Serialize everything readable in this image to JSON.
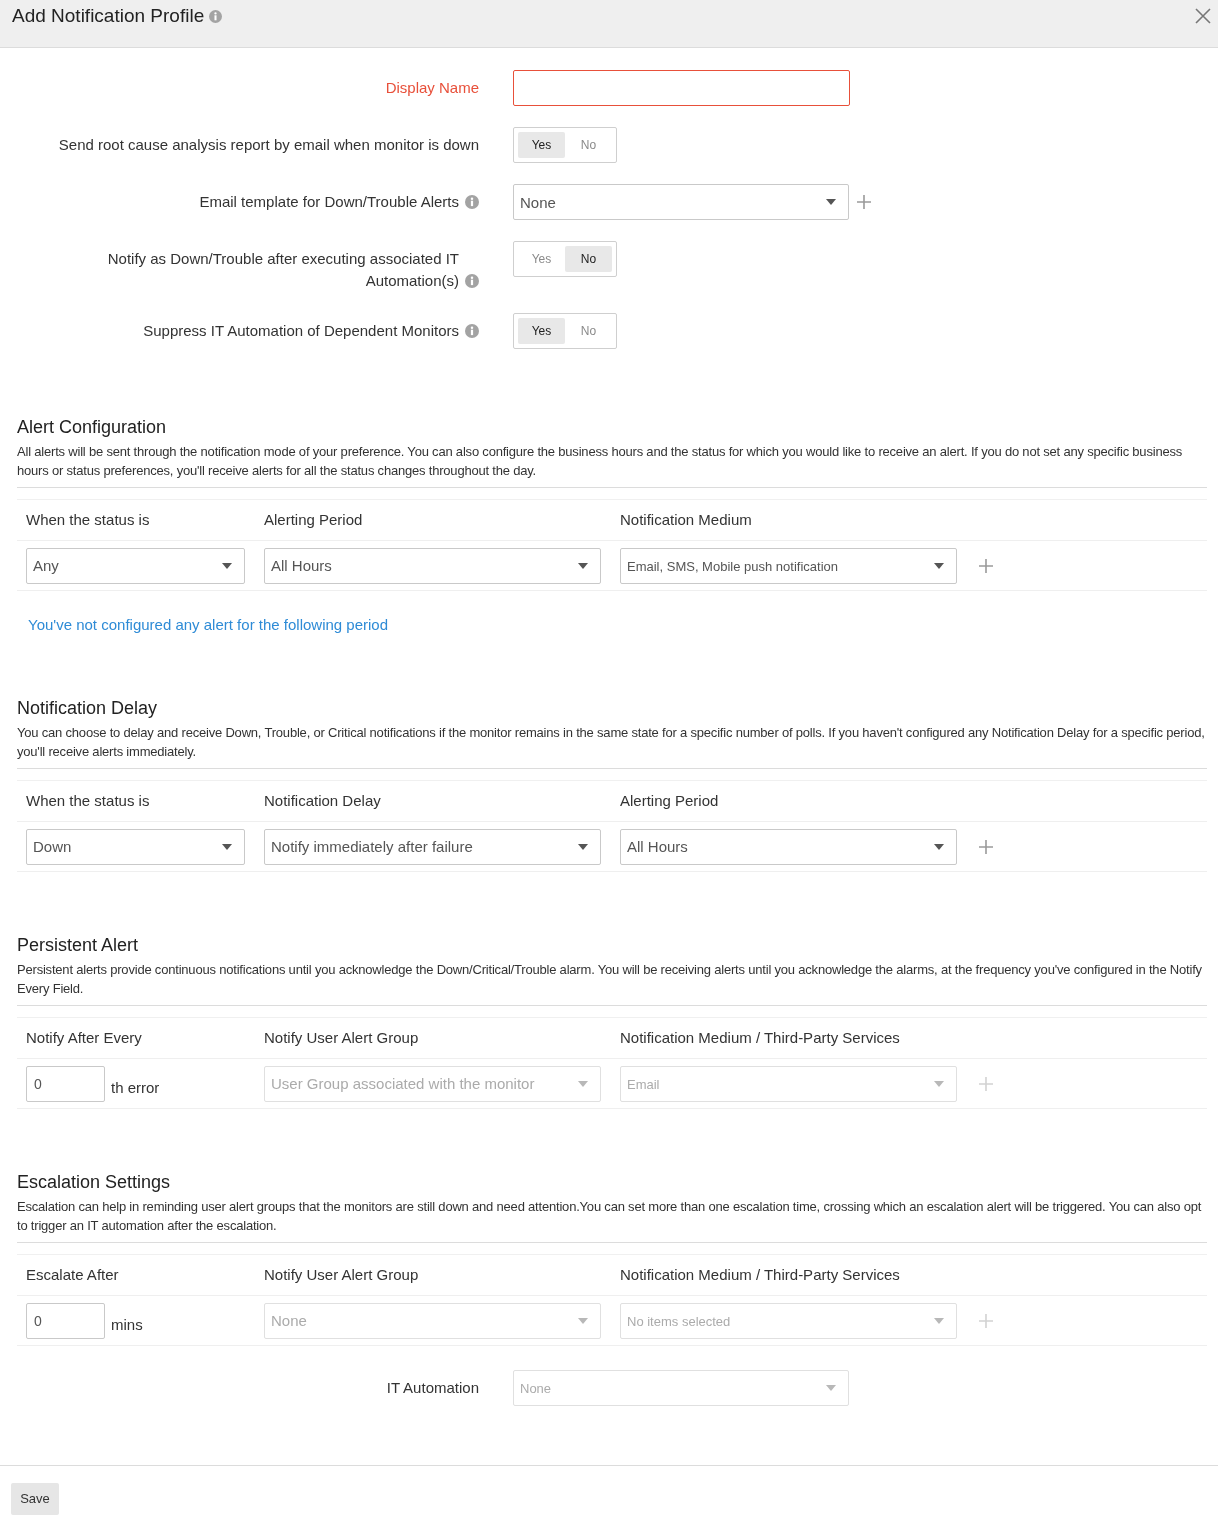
{
  "dialog": {
    "title": "Add Notification Profile"
  },
  "form_rows": [
    {
      "label": "Display Name",
      "kind": "text",
      "error": true,
      "info": false
    },
    {
      "label": "Send root cause analysis report by email when monitor is down",
      "kind": "toggle",
      "info": false,
      "options": [
        {
          "label": "Yes",
          "selected": true
        },
        {
          "label": "No",
          "selected": false
        }
      ]
    },
    {
      "label": "Email template for Down/Trouble Alerts",
      "kind": "select",
      "info": true,
      "value": "None",
      "disabled": false,
      "add_button": true
    },
    {
      "label": "Notify as Down/Trouble after executing associated IT Automation(s)",
      "kind": "toggle",
      "info": true,
      "options": [
        {
          "label": "Yes",
          "selected": false
        },
        {
          "label": "No",
          "selected": true
        }
      ]
    },
    {
      "label": "Suppress IT Automation of Dependent Monitors",
      "kind": "toggle",
      "info": true,
      "options": [
        {
          "label": "Yes",
          "selected": true
        },
        {
          "label": "No",
          "selected": false
        }
      ]
    }
  ],
  "sections": [
    {
      "title": "Alert Configuration",
      "description": "All alerts will be sent through the notification mode of your preference. You can also configure the business hours and the status for which you would like to receive an alert. If you do not set any specific business hours or status preferences, you'll receive alerts for all the status changes throughout the day.",
      "columns": [
        "When the status is",
        "Alerting Period",
        "Notification Medium"
      ],
      "rows": [
        {
          "cells": [
            {
              "kind": "select",
              "value": "Any",
              "disabled": false
            },
            {
              "kind": "select",
              "value": "All Hours",
              "disabled": false
            },
            {
              "kind": "multiselect",
              "value": "Email, SMS, Mobile push notification",
              "disabled": false
            }
          ],
          "add_disabled": false
        }
      ],
      "link": "You've not configured any alert for the following period"
    },
    {
      "title": "Notification Delay",
      "description": "You can choose to delay and receive Down, Trouble, or Critical notifications if the monitor remains in the same state for a specific number of polls. If you haven't configured any Notification Delay for a specific period, you'll receive alerts immediately.",
      "columns": [
        "When the status is",
        "Notification Delay",
        "Alerting Period"
      ],
      "rows": [
        {
          "cells": [
            {
              "kind": "select",
              "value": "Down",
              "disabled": false
            },
            {
              "kind": "select",
              "value": "Notify immediately after failure",
              "disabled": false
            },
            {
              "kind": "select",
              "value": "All Hours",
              "disabled": false
            }
          ],
          "add_disabled": false
        }
      ]
    },
    {
      "title": "Persistent Alert",
      "description": "Persistent alerts provide continuous notifications until you acknowledge the Down/Critical/Trouble alarm. You will be receiving alerts until you acknowledge the alarms, at the frequency you've configured in the Notify Every Field.",
      "columns": [
        "Notify After Every",
        "Notify User Alert Group",
        "Notification Medium / Third-Party Services"
      ],
      "rows": [
        {
          "cells": [
            {
              "kind": "number",
              "value": "0",
              "suffix": "th error",
              "disabled": false
            },
            {
              "kind": "select",
              "value": "User Group associated with the monitor",
              "disabled": true
            },
            {
              "kind": "multiselect",
              "value": "Email",
              "disabled": true
            }
          ],
          "add_disabled": true
        }
      ]
    },
    {
      "title": "Escalation Settings",
      "description": "Escalation can help in reminding user alert groups that the monitors are still down and need attention.You can set more than one escalation time, crossing which an escalation alert will be triggered. You can also opt to trigger an IT automation after the escalation.",
      "columns": [
        "Escalate After",
        "Notify User Alert Group",
        "Notification Medium / Third-Party Services"
      ],
      "rows": [
        {
          "cells": [
            {
              "kind": "number",
              "value": "0",
              "suffix": "mins",
              "disabled": false
            },
            {
              "kind": "select",
              "value": "None",
              "disabled": true
            },
            {
              "kind": "multiselect",
              "value": "No items selected",
              "disabled": true
            }
          ],
          "add_disabled": true
        }
      ],
      "fields": [
        {
          "label": "IT Automation",
          "kind": "multiselect",
          "info": false,
          "value": "None",
          "disabled": true
        }
      ]
    }
  ],
  "save_button": "Save"
}
